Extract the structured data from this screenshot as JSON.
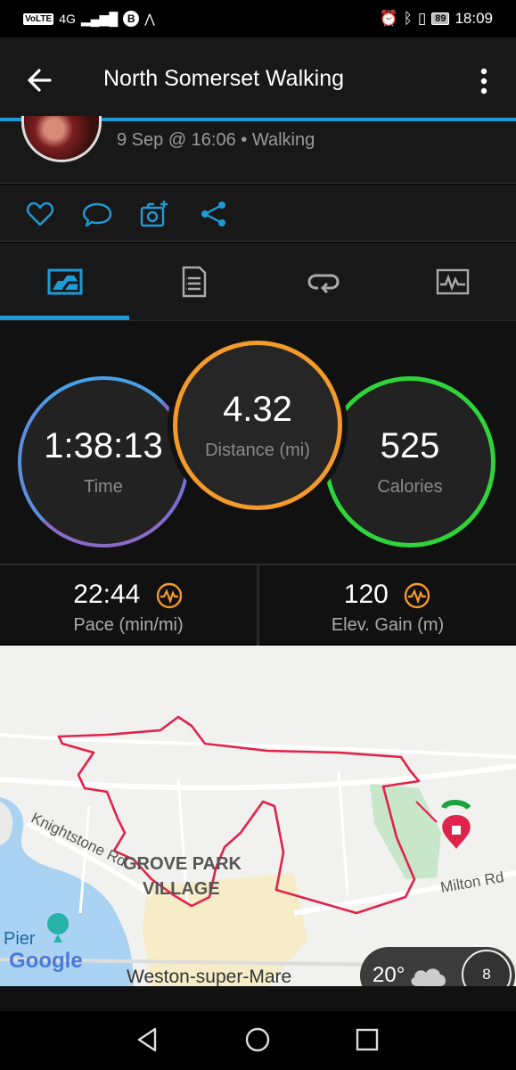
{
  "status_bar": {
    "volte": "VoLTE",
    "network": "4G",
    "battery": "89",
    "time": "18:09"
  },
  "app_bar": {
    "title": "North Somerset Walking"
  },
  "activity": {
    "meta": "9 Sep @ 16:06 • Walking"
  },
  "stats": {
    "time": {
      "value": "1:38:13",
      "label": "Time"
    },
    "distance": {
      "value": "4.32",
      "label": "Distance (mi)"
    },
    "calories": {
      "value": "525",
      "label": "Calories"
    }
  },
  "metrics": {
    "pace": {
      "value": "22:44",
      "label": "Pace (min/mi)"
    },
    "elevation": {
      "value": "120",
      "label": "Elev. Gain (m)"
    }
  },
  "map": {
    "labels": {
      "knightstone": "Knightstone Rd",
      "grove1": "GROVE PARK",
      "grove2": "VILLAGE",
      "milton": "Milton Rd",
      "pier": "Pier",
      "google": "Google",
      "town": "Weston-super-Mare"
    },
    "weather": {
      "temp": "20°",
      "wind": "8"
    }
  },
  "colors": {
    "accent": "#1e9bd7",
    "time_ring": "#7b6fd4",
    "distance_ring": "#f39a2a",
    "calories_ring": "#2fd43a",
    "route": "#e0234a"
  }
}
